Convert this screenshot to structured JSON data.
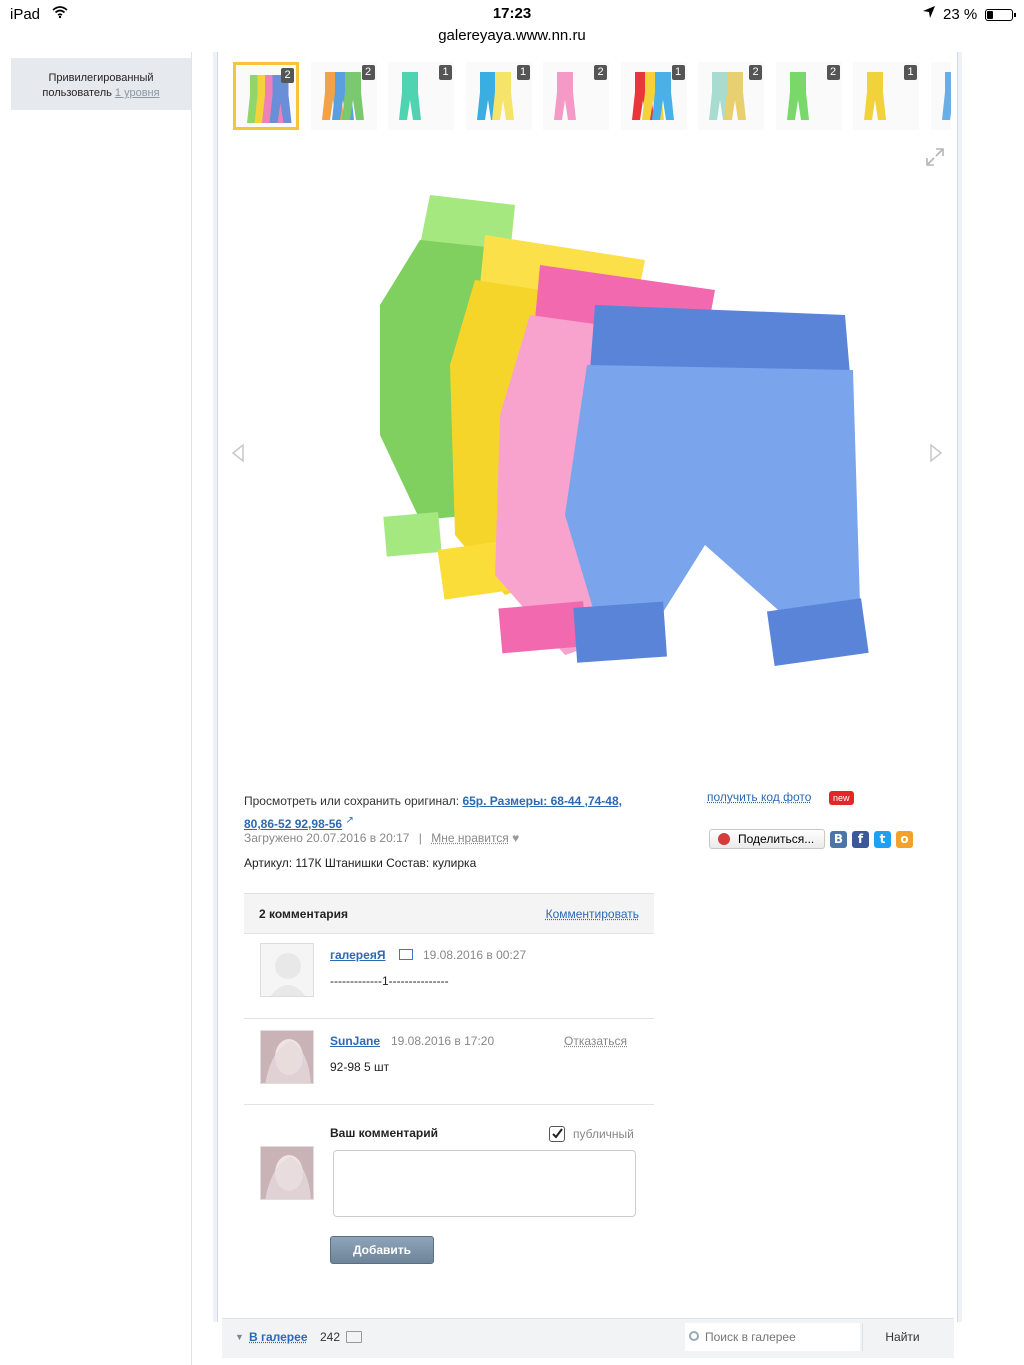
{
  "status_bar": {
    "device": "iPad",
    "time": "17:23",
    "battery": "23 %",
    "url": "galereyaya.www.nn.ru"
  },
  "user_box": {
    "line1": "Привилегированный",
    "line2": "пользователь",
    "level": "1 уровня"
  },
  "thumbnails": [
    {
      "count": "2",
      "colors": [
        "#8fd66b",
        "#f3d23a",
        "#f080b8",
        "#6a8fd8"
      ],
      "selected": true
    },
    {
      "count": "2",
      "colors": [
        "#f2a24a",
        "#5aa0e0",
        "#7bc96f"
      ]
    },
    {
      "count": "1",
      "colors": [
        "#4fd3b0"
      ]
    },
    {
      "count": "1",
      "colors": [
        "#3aaee0",
        "#f5e36a"
      ]
    },
    {
      "count": "2",
      "colors": [
        "#f59ac6"
      ]
    },
    {
      "count": "1",
      "colors": [
        "#e8363a",
        "#f6d23a",
        "#4ab0e8"
      ]
    },
    {
      "count": "2",
      "colors": [
        "#a8dcd0",
        "#e8d070"
      ]
    },
    {
      "count": "2",
      "colors": [
        "#7ad86a"
      ]
    },
    {
      "count": "1",
      "colors": [
        "#f2d23a"
      ]
    },
    {
      "count": "",
      "colors": [
        "#6aaee8"
      ]
    }
  ],
  "info": {
    "view_prefix": "Просмотреть или сохранить оригинал:",
    "view_link": "65р. Размеры: 68-44 ,74-48, 80,86-52 92,98-56",
    "uploaded": "Загружено 20.07.2016 в 20:17",
    "separator": "|",
    "like": "Мне нравится",
    "article": "Артикул: 117К Штанишки Состав: кулирка"
  },
  "side_actions": {
    "get_code": "получить код фото",
    "new_badge": "new",
    "share": "Поделиться..."
  },
  "comments": {
    "title": "2 комментария",
    "comment_link": "Комментировать",
    "items": [
      {
        "author": "галереяЯ",
        "date": "19.08.2016 в 00:27",
        "text": "-------------1---------------"
      },
      {
        "author": "SunJane",
        "date": "19.08.2016 в 17:20",
        "text": "92-98 5 шт",
        "refuse": "Отказаться"
      }
    ],
    "reply_label": "Ваш комментарий",
    "public_label": "публичный",
    "add_button": "Добавить"
  },
  "bottom_bar": {
    "gallery_label": "В галерее",
    "gallery_count": "242",
    "search_placeholder": "Поиск в галерее",
    "find_button": "Найти"
  },
  "colors": {
    "link": "#2d68b3",
    "selected_thumb": "#f2c53a",
    "new_badge": "#e0282a"
  },
  "icons": [
    "wifi-icon",
    "location-arrow-icon",
    "battery-icon",
    "expand-icon",
    "arrow-left-icon",
    "arrow-right-icon",
    "external-link-icon",
    "heart-icon",
    "share-icon",
    "vk-icon",
    "facebook-icon",
    "twitter-icon",
    "odnoklassniki-icon",
    "mail-icon",
    "checkbox-checked-icon",
    "search-icon",
    "folder-icon",
    "triangle-down-icon"
  ]
}
